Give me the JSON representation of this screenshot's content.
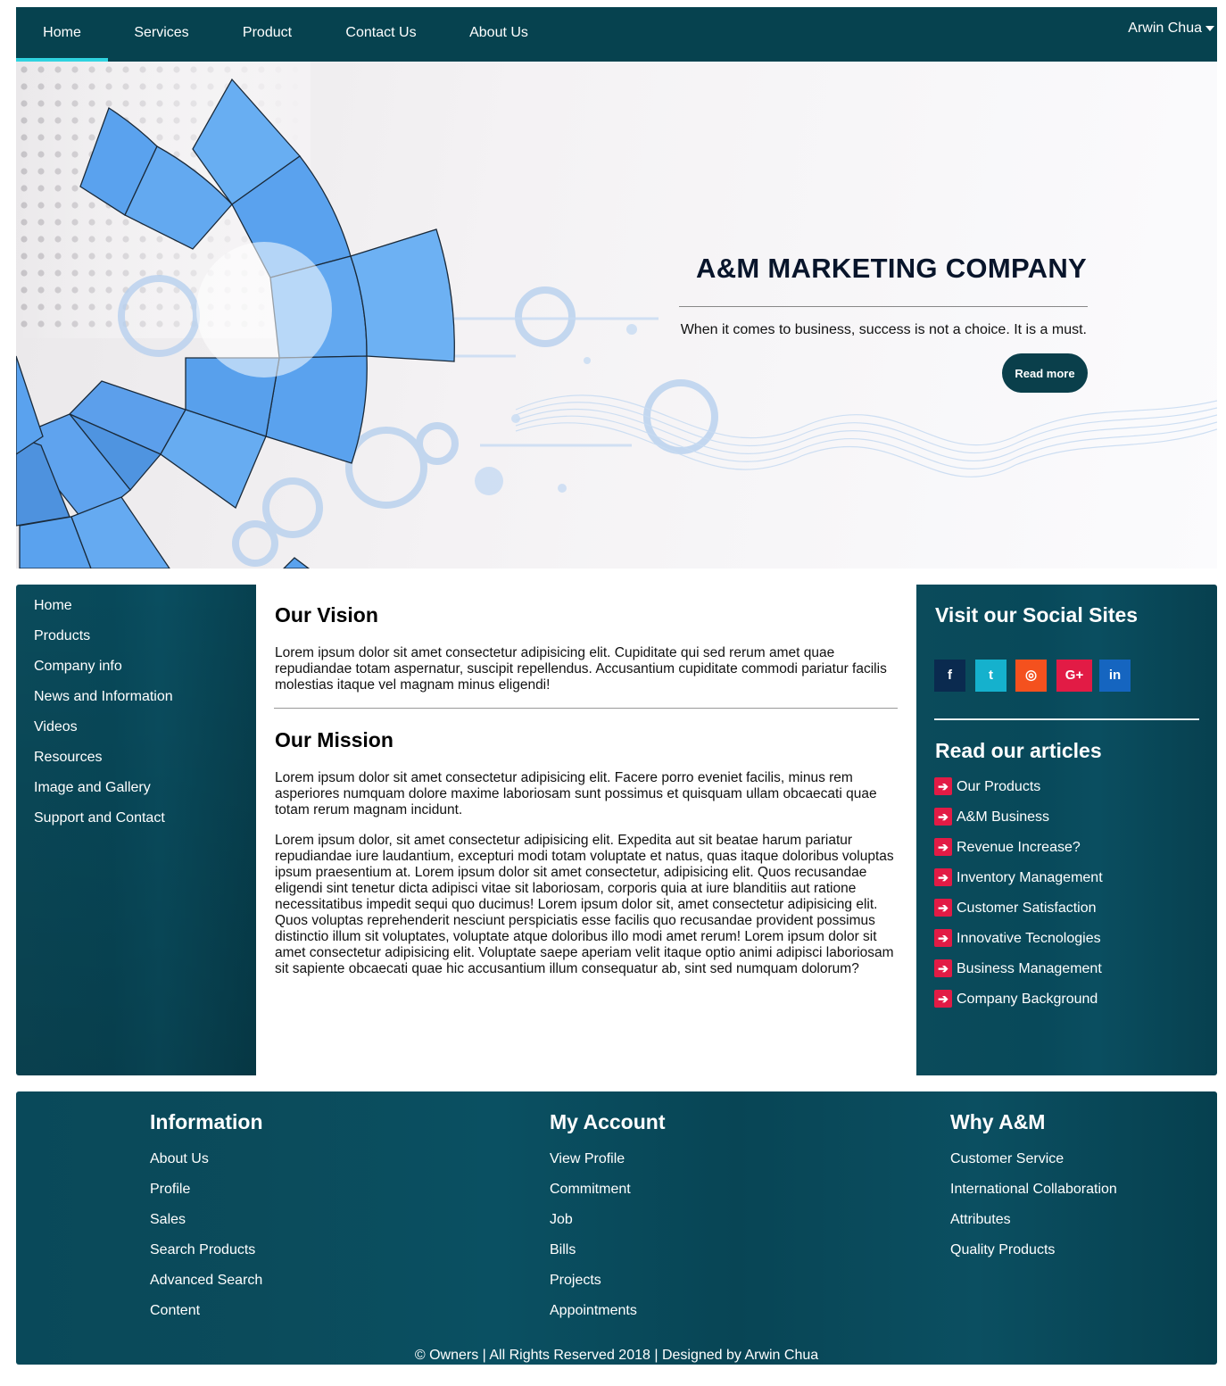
{
  "nav": {
    "items": [
      "Home",
      "Services",
      "Product",
      "Contact Us",
      "About Us"
    ],
    "active": "Home",
    "user": "Arwin Chua"
  },
  "hero": {
    "title": "A&M MARKETING COMPANY",
    "tagline": "When it comes to business, success is not a choice. It is a must.",
    "button": "Read more"
  },
  "sidebar": {
    "items": [
      "Home",
      "Products",
      "Company info",
      "News and Information",
      "Videos",
      "Resources",
      "Image and Gallery",
      "Support and Contact"
    ]
  },
  "main": {
    "vision_heading": "Our Vision",
    "vision_text": "Lorem ipsum dolor sit amet consectetur adipisicing elit. Cupiditate qui sed rerum amet quae repudiandae totam aspernatur, suscipit repellendus. Accusantium cupiditate commodi pariatur facilis molestias itaque vel magnam minus eligendi!",
    "mission_heading": "Our Mission",
    "mission_text_1": "Lorem ipsum dolor sit amet consectetur adipisicing elit. Facere porro eveniet facilis, minus rem asperiores numquam dolore maxime laboriosam sunt possimus et quisquam ullam obcaecati quae totam rerum magnam incidunt.",
    "mission_text_2": "Lorem ipsum dolor, sit amet consectetur adipisicing elit. Expedita aut sit beatae harum pariatur repudiandae iure laudantium, excepturi modi totam voluptate et natus, quas itaque doloribus voluptas ipsum praesentium at. Lorem ipsum dolor sit amet consectetur, adipisicing elit. Quos recusandae eligendi sint tenetur dicta adipisci vitae sit laboriosam, corporis quia at iure blanditiis aut ratione necessitatibus impedit sequi quo ducimus! Lorem ipsum dolor sit, amet consectetur adipisicing elit. Quos voluptas reprehenderit nesciunt perspiciatis esse facilis quo recusandae provident possimus distinctio illum sit voluptates, voluptate atque doloribus illo modi amet rerum! Lorem ipsum dolor sit amet consectetur adipisicing elit. Voluptate saepe aperiam velit itaque optio animi adipisci laboriosam sit sapiente obcaecati quae hic accusantium illum consequatur ab, sint sed numquam dolorum?"
  },
  "right": {
    "social_heading": "Visit our Social Sites",
    "social": [
      {
        "icon": "facebook-icon",
        "glyph": "f",
        "color": "#0a2a4f"
      },
      {
        "icon": "twitter-icon",
        "glyph": "t",
        "color": "#15b1cd"
      },
      {
        "icon": "instagram-icon",
        "glyph": "◎",
        "color": "#f4511e"
      },
      {
        "icon": "google-plus-icon",
        "glyph": "G+",
        "color": "#e21b45"
      },
      {
        "icon": "linkedin-icon",
        "glyph": "in",
        "color": "#1565c0"
      }
    ],
    "articles_heading": "Read our articles",
    "articles": [
      "Our Products",
      "A&M Business",
      "Revenue Increase?",
      "Inventory Management",
      "Customer Satisfaction",
      "Innovative Tecnologies",
      "Business Management",
      "Company Background"
    ]
  },
  "footer": {
    "col1": {
      "heading": "Information",
      "links": [
        "About Us",
        "Profile",
        "Sales",
        "Search Products",
        "Advanced Search",
        "Content"
      ]
    },
    "col2": {
      "heading": "My Account",
      "links": [
        "View Profile",
        "Commitment",
        "Job",
        "Bills",
        "Projects",
        "Appointments"
      ]
    },
    "col3": {
      "heading": "Why A&M",
      "links": [
        "Customer Service",
        "International Collaboration",
        "Attributes",
        "Quality Products"
      ]
    },
    "copyright": "© Owners | All Rights Reserved 2018 | Designed by Arwin Chua"
  }
}
